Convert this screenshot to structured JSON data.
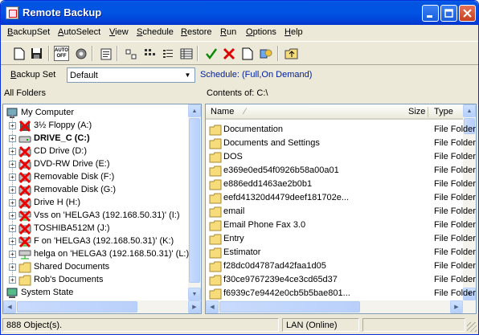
{
  "window": {
    "title": "Remote Backup"
  },
  "menu": [
    {
      "label": "BackupSet",
      "u": "B",
      "rest": "ackupSet"
    },
    {
      "label": "AutoSelect",
      "u": "A",
      "rest": "utoSelect"
    },
    {
      "label": "View",
      "u": "V",
      "rest": "iew"
    },
    {
      "label": "Schedule",
      "u": "S",
      "rest": "chedule"
    },
    {
      "label": "Restore",
      "u": "R",
      "rest": "estore"
    },
    {
      "label": "Run",
      "u": "R",
      "rest": "un"
    },
    {
      "label": "Options",
      "u": "O",
      "rest": "ptions"
    },
    {
      "label": "Help",
      "u": "H",
      "rest": "elp"
    }
  ],
  "toolbar": {
    "auto_off_text": "AUTO OFF"
  },
  "backupset": {
    "label_u": "B",
    "label_rest": "ackup Set",
    "value": "Default",
    "schedule": "Schedule: (Full,On Demand)"
  },
  "left": {
    "header": "All Folders",
    "root": "My Computer",
    "items": [
      {
        "label": "3½ Floppy (A:)",
        "icon": "floppy-icon",
        "x": true,
        "bold": false
      },
      {
        "label": "DRIVE_C (C:)",
        "icon": "hard-drive-icon",
        "x": false,
        "bold": true
      },
      {
        "label": "CD Drive (D:)",
        "icon": "cd-drive-icon",
        "x": true,
        "bold": false
      },
      {
        "label": "DVD-RW Drive (E:)",
        "icon": "dvd-drive-icon",
        "x": true,
        "bold": false
      },
      {
        "label": "Removable Disk (F:)",
        "icon": "removable-disk-icon",
        "x": true,
        "bold": false
      },
      {
        "label": "Removable Disk (G:)",
        "icon": "removable-disk-icon",
        "x": true,
        "bold": false
      },
      {
        "label": "Drive H (H:)",
        "icon": "drive-icon",
        "x": true,
        "bold": false
      },
      {
        "label": "Vss on 'HELGA3 (192.168.50.31)' (I:)",
        "icon": "network-drive-icon",
        "x": true,
        "bold": false
      },
      {
        "label": "TOSHIBA512M (J:)",
        "icon": "removable-disk-icon",
        "x": true,
        "bold": false
      },
      {
        "label": "F on 'HELGA3 (192.168.50.31)' (K:)",
        "icon": "network-drive-icon",
        "x": true,
        "bold": false
      },
      {
        "label": "helga on 'HELGA3 (192.168.50.31)' (L:)",
        "icon": "network-drive-icon",
        "x": false,
        "bold": false
      },
      {
        "label": "Shared Documents",
        "icon": "folder-icon",
        "x": false,
        "bold": false
      },
      {
        "label": "Rob's Documents",
        "icon": "folder-icon",
        "x": false,
        "bold": false
      }
    ],
    "last": "System State"
  },
  "right": {
    "header": "Contents of: C:\\",
    "columns": {
      "name": "Name",
      "size": "Size",
      "type": "Type"
    },
    "files": [
      {
        "name": "Documentation",
        "type": "File Folder"
      },
      {
        "name": "Documents and Settings",
        "type": "File Folder"
      },
      {
        "name": "DOS",
        "type": "File Folder"
      },
      {
        "name": "e369e0ed54f0926b58a00a01",
        "type": "File Folder"
      },
      {
        "name": "e886edd1463ae2b0b1",
        "type": "File Folder"
      },
      {
        "name": "eefd41320d4479deef181702e...",
        "type": "File Folder"
      },
      {
        "name": "email",
        "type": "File Folder"
      },
      {
        "name": "Email Phone Fax 3.0",
        "type": "File Folder"
      },
      {
        "name": "Entry",
        "type": "File Folder"
      },
      {
        "name": "Estimator",
        "type": "File Folder"
      },
      {
        "name": "f28dc0d4787ad42faa1d05",
        "type": "File Folder"
      },
      {
        "name": "f30ce9767239e4ce3cd65d37",
        "type": "File Folder"
      },
      {
        "name": "f6939c7e9442e0cb5b5bae801...",
        "type": "File Folder"
      }
    ]
  },
  "status": {
    "count": "888 Object(s).",
    "connection": "LAN (Online)"
  }
}
